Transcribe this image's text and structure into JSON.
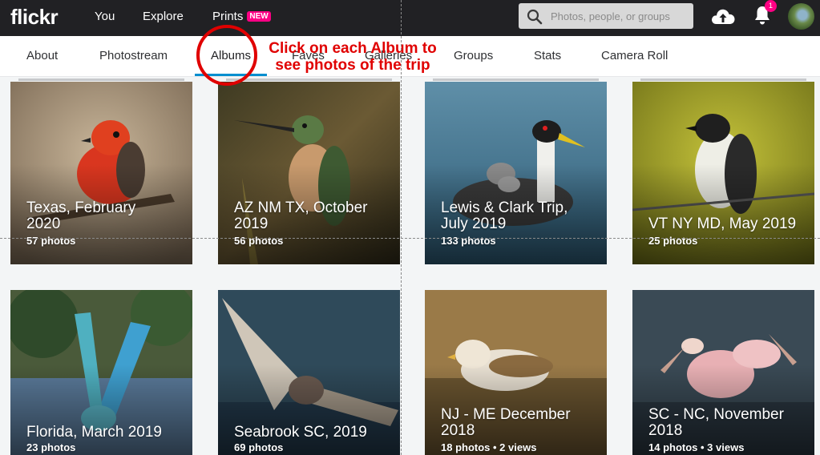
{
  "brand": {
    "logo": "flickr"
  },
  "topnav": {
    "you": "You",
    "explore": "Explore",
    "prints": "Prints",
    "prints_badge": "NEW"
  },
  "search": {
    "placeholder": "Photos, people, or groups"
  },
  "notifications": {
    "count": "1"
  },
  "tabs": [
    {
      "label": "About"
    },
    {
      "label": "Photostream"
    },
    {
      "label": "Albums",
      "active": true
    },
    {
      "label": "Faves"
    },
    {
      "label": "Galleries"
    },
    {
      "label": "Groups"
    },
    {
      "label": "Stats"
    },
    {
      "label": "Camera Roll"
    }
  ],
  "annotation": {
    "line1": "Click on each Album to",
    "line2": "see photos of the trip"
  },
  "albums": [
    {
      "title1": "Texas, February",
      "title2": "2020",
      "meta": "57 photos"
    },
    {
      "title1": "AZ NM TX, October",
      "title2": "2019",
      "meta": "56 photos"
    },
    {
      "title1": "Lewis & Clark Trip,",
      "title2": "July 2019",
      "meta": "133 photos"
    },
    {
      "title1": "VT NY MD, May 2019",
      "title2": "",
      "meta": "25 photos"
    },
    {
      "title1": "Florida, March 2019",
      "title2": "",
      "meta": "23 photos"
    },
    {
      "title1": "Seabrook SC, 2019",
      "title2": "",
      "meta": "69 photos"
    },
    {
      "title1": "NJ - ME December",
      "title2": "2018",
      "meta": "18 photos  •  2 views"
    },
    {
      "title1": "SC - NC, November",
      "title2": "2018",
      "meta": "14 photos  •  3 views"
    }
  ],
  "colors": {
    "topbar": "#212124",
    "accent": "#008ecf",
    "badge": "#ff0084",
    "annotation": "#e00000"
  }
}
